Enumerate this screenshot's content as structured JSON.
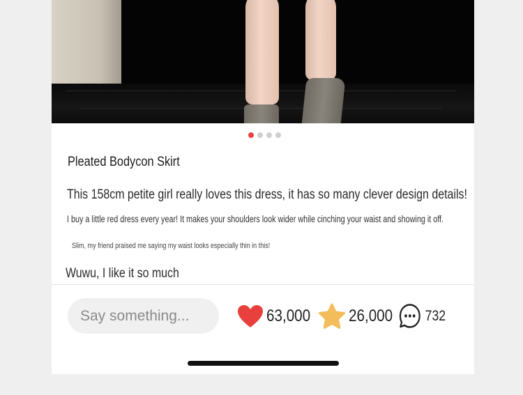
{
  "post": {
    "title": "Pleated Bodycon Skirt",
    "headline": "This 158cm petite girl really loves this dress, it has so many clever design details!",
    "body_line_1": "I buy a little red dress every year! It makes your shoulders look wider while cinching your waist and showing it off.",
    "body_line_2": "Slim, my friend praised me saying my waist looks especially thin in this!",
    "comment_preview": "Wuwu, I like it so much"
  },
  "gallery": {
    "image_count": 4,
    "active_index": 0,
    "active_dot_color": "#e8413d",
    "inactive_dot_color": "#cfcfcf"
  },
  "action_bar": {
    "input_placeholder": "Say something...",
    "likes": {
      "icon": "heart-icon",
      "count": "63,000",
      "color": "#e8413d"
    },
    "favorites": {
      "icon": "star-icon",
      "count": "26,000",
      "color": "#f2bd5a"
    },
    "comments": {
      "icon": "chat-bubble-icon",
      "count": "732"
    }
  }
}
